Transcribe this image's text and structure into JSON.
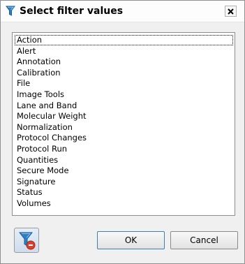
{
  "dialog": {
    "title": "Select filter values",
    "close_label": "×"
  },
  "list": {
    "items": [
      "Action",
      "Alert",
      "Annotation",
      "Calibration",
      "File",
      "Image Tools",
      "Lane and Band",
      "Molecular Weight",
      "Normalization",
      "Protocol Changes",
      "Protocol Run",
      "Quantities",
      "Secure Mode",
      "Signature",
      "Status",
      "Volumes"
    ],
    "focused_index": 0
  },
  "buttons": {
    "ok_label": "OK",
    "cancel_label": "Cancel"
  },
  "icons": {
    "title_icon": "filter-icon",
    "clear_filter_icon": "clear-filter-icon"
  },
  "colors": {
    "filter_blue": "#2f7fc4",
    "clear_red": "#d9412e"
  }
}
